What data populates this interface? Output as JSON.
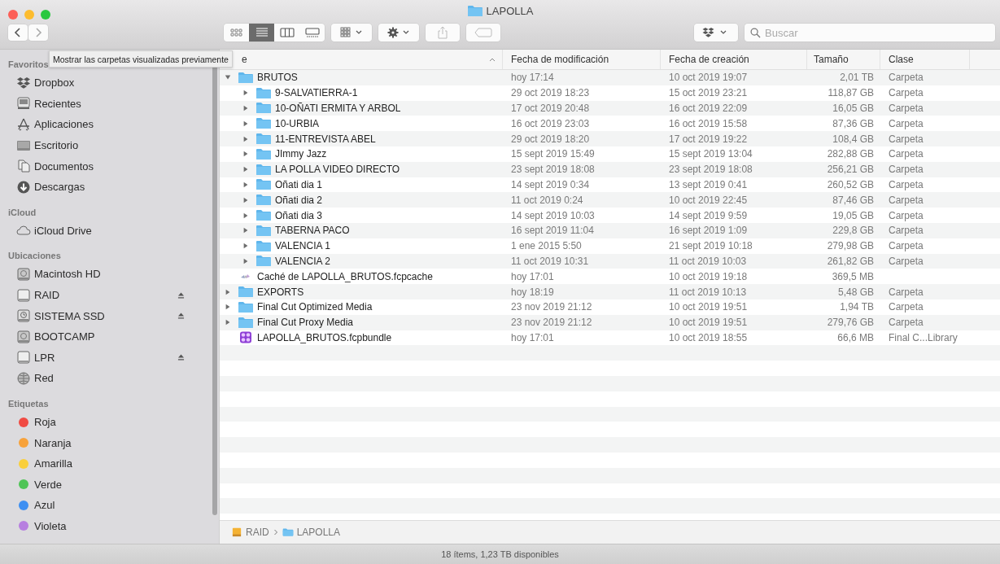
{
  "window": {
    "title": "LAPOLLA"
  },
  "toolbar": {
    "view_modes": [
      {
        "kind": "icons",
        "selected": false
      },
      {
        "kind": "list",
        "selected": true
      },
      {
        "kind": "columns",
        "selected": false
      },
      {
        "kind": "gallery",
        "selected": false
      }
    ],
    "search": {
      "placeholder": "Buscar"
    }
  },
  "tooltip": "Mostrar las carpetas visualizadas previamente",
  "sidebar": {
    "sections": [
      {
        "title": "Favoritos",
        "items": [
          {
            "label": "Dropbox"
          },
          {
            "label": "Recientes"
          },
          {
            "label": "Aplicaciones"
          },
          {
            "label": "Escritorio"
          },
          {
            "label": "Documentos"
          },
          {
            "label": "Descargas"
          }
        ]
      },
      {
        "title": "iCloud",
        "items": [
          {
            "label": "iCloud Drive"
          }
        ]
      },
      {
        "title": "Ubicaciones",
        "items": [
          {
            "label": "Macintosh HD",
            "ejectable": false
          },
          {
            "label": "RAID",
            "ejectable": true
          },
          {
            "label": "SISTEMA SSD",
            "ejectable": true
          },
          {
            "label": "BOOTCAMP",
            "ejectable": false
          },
          {
            "label": "LPR",
            "ejectable": true
          },
          {
            "label": "Red",
            "ejectable": false
          }
        ]
      },
      {
        "title": "Etiquetas",
        "items": [
          {
            "label": "Roja",
            "color": "#f04b43"
          },
          {
            "label": "Naranja",
            "color": "#f7a23b"
          },
          {
            "label": "Amarilla",
            "color": "#f9cf3c"
          },
          {
            "label": "Verde",
            "color": "#4fc456"
          },
          {
            "label": "Azul",
            "color": "#3d8ff2"
          },
          {
            "label": "Violeta",
            "color": "#b77fe0"
          }
        ]
      }
    ]
  },
  "table": {
    "columns": [
      "e",
      "Fecha de modificación",
      "Fecha de creación",
      "Tamaño",
      "Clase"
    ],
    "rows": [
      {
        "name": "BRUTOS",
        "kind": "folder",
        "expanded": true,
        "modified": "hoy 17:14",
        "created": "10 oct 2019 19:07",
        "size": "2,01 TB",
        "type": "Carpeta",
        "children": [
          {
            "name": "9-SALVATIERRA-1",
            "kind": "folder",
            "expanded": false,
            "modified": "29 oct 2019 18:23",
            "created": "15 oct 2019 23:21",
            "size": "118,87 GB",
            "type": "Carpeta"
          },
          {
            "name": "10-OÑATI ERMITA Y ARBOL",
            "kind": "folder",
            "expanded": false,
            "modified": "17 oct 2019 20:48",
            "created": "16 oct 2019 22:09",
            "size": "16,05 GB",
            "type": "Carpeta"
          },
          {
            "name": "10-URBIA",
            "kind": "folder",
            "expanded": false,
            "modified": "16 oct 2019 23:03",
            "created": "16 oct 2019 15:58",
            "size": "87,36 GB",
            "type": "Carpeta"
          },
          {
            "name": "11-ENTREVISTA ABEL",
            "kind": "folder",
            "expanded": false,
            "modified": "29 oct 2019 18:20",
            "created": "17 oct 2019 19:22",
            "size": "108,4 GB",
            "type": "Carpeta"
          },
          {
            "name": "JImmy Jazz",
            "kind": "folder",
            "expanded": false,
            "modified": "15 sept 2019 15:49",
            "created": "15 sept 2019 13:04",
            "size": "282,88 GB",
            "type": "Carpeta"
          },
          {
            "name": "LA POLLA VIDEO DIRECTO",
            "kind": "folder",
            "expanded": false,
            "modified": "23 sept 2019 18:08",
            "created": "23 sept 2019 18:08",
            "size": "256,21 GB",
            "type": "Carpeta"
          },
          {
            "name": "Oñati dia 1",
            "kind": "folder",
            "expanded": false,
            "modified": "14 sept 2019 0:34",
            "created": "13 sept 2019 0:41",
            "size": "260,52 GB",
            "type": "Carpeta"
          },
          {
            "name": "Oñati dia 2",
            "kind": "folder",
            "expanded": false,
            "modified": "11 oct 2019 0:24",
            "created": "10 oct 2019 22:45",
            "size": "87,46 GB",
            "type": "Carpeta"
          },
          {
            "name": "Oñati dia 3",
            "kind": "folder",
            "expanded": false,
            "modified": "14 sept 2019 10:03",
            "created": "14 sept 2019 9:59",
            "size": "19,05 GB",
            "type": "Carpeta"
          },
          {
            "name": "TABERNA PACO",
            "kind": "folder",
            "expanded": false,
            "modified": "16 sept 2019 11:04",
            "created": "16 sept 2019 1:09",
            "size": "229,8 GB",
            "type": "Carpeta"
          },
          {
            "name": "VALENCIA 1",
            "kind": "folder",
            "expanded": false,
            "modified": "1 ene 2015 5:50",
            "created": "21 sept 2019 10:18",
            "size": "279,98 GB",
            "type": "Carpeta"
          },
          {
            "name": "VALENCIA 2",
            "kind": "folder",
            "expanded": false,
            "modified": "11 oct 2019 10:31",
            "created": "11 oct 2019 10:03",
            "size": "261,82 GB",
            "type": "Carpeta"
          }
        ]
      },
      {
        "name": "Caché de LAPOLLA_BRUTOS.fcpcache",
        "kind": "cache",
        "modified": "hoy 17:01",
        "created": "10 oct 2019 19:18",
        "size": "369,5 MB"
      },
      {
        "name": "EXPORTS",
        "kind": "folder",
        "expanded": false,
        "modified": "hoy 18:19",
        "created": "11 oct 2019 10:13",
        "size": "5,48 GB",
        "type": "Carpeta"
      },
      {
        "name": "Final Cut Optimized Media",
        "kind": "folder",
        "expanded": false,
        "modified": "23 nov 2019 21:12",
        "created": "10 oct 2019 19:51",
        "size": "1,94 TB",
        "type": "Carpeta"
      },
      {
        "name": "Final Cut Proxy Media",
        "kind": "folder",
        "expanded": false,
        "modified": "23 nov 2019 21:12",
        "created": "10 oct 2019 19:51",
        "size": "279,76 GB",
        "type": "Carpeta"
      },
      {
        "name": "LAPOLLA_BRUTOS.fcpbundle",
        "kind": "bundle",
        "modified": "hoy 17:01",
        "created": "10 oct 2019 18:55",
        "size": "66,6 MB",
        "type": "Final C...Library"
      }
    ]
  },
  "path_bar": [
    {
      "label": "RAID"
    },
    {
      "label": "LAPOLLA"
    }
  ],
  "status_bar": "18 ítems, 1,23 TB disponibles"
}
